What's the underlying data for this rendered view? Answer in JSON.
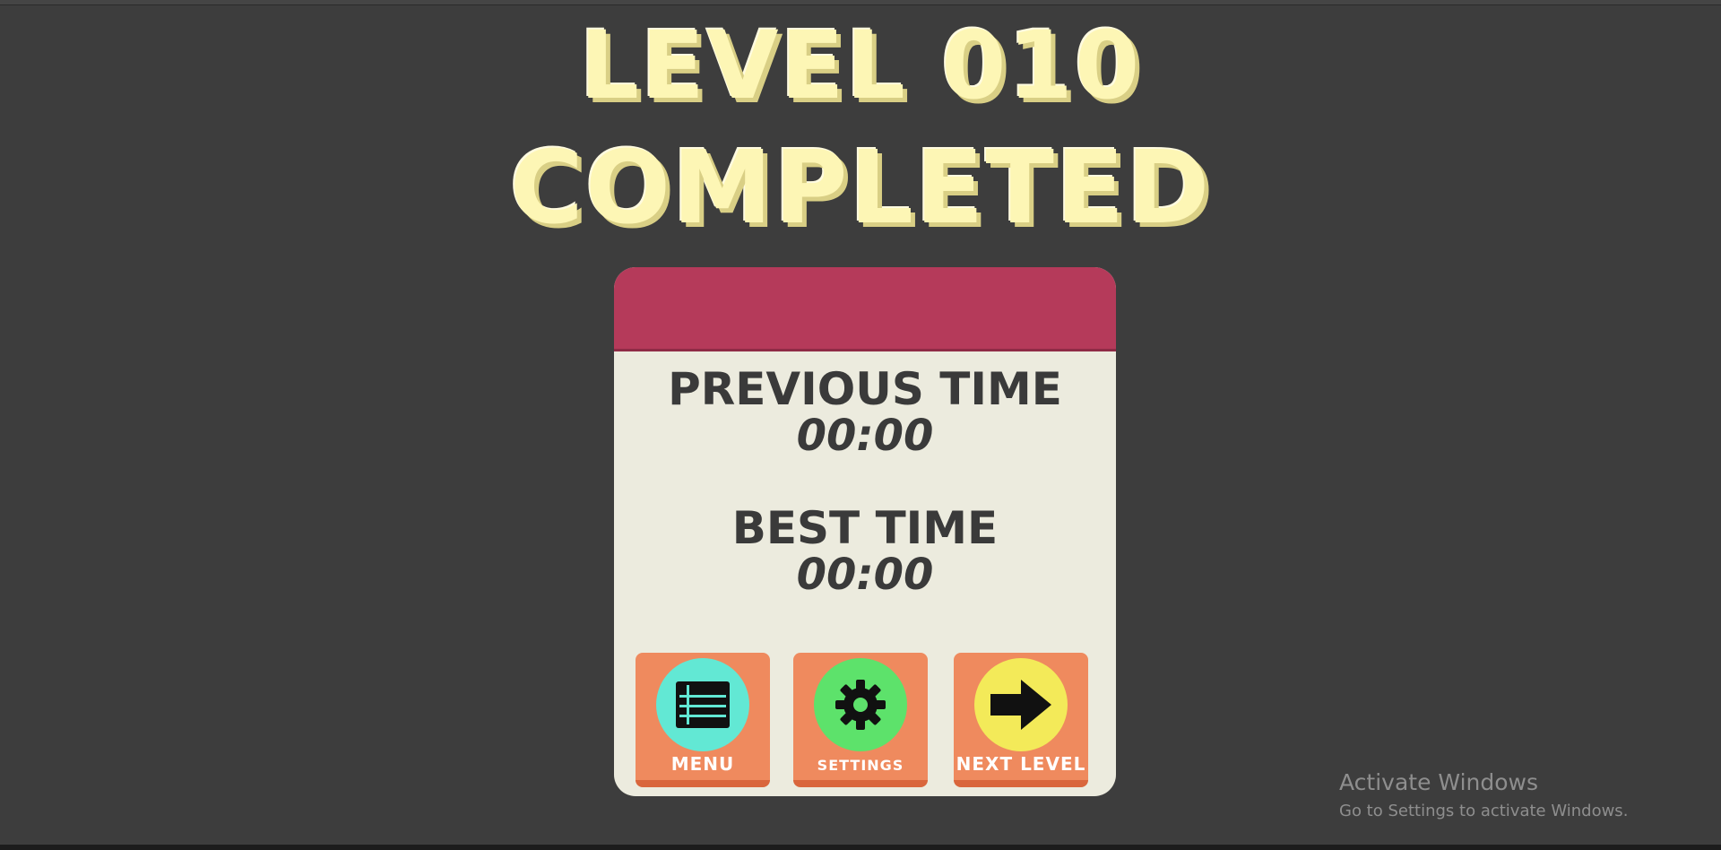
{
  "title": {
    "line1": "LEVEL 010",
    "line2": "COMPLETED"
  },
  "stats": {
    "previous_label": "PREVIOUS TIME",
    "previous_value": "00:00",
    "best_label": "BEST TIME",
    "best_value": "00:00"
  },
  "buttons": {
    "menu": {
      "label": "MENU",
      "icon": "list-icon"
    },
    "settings": {
      "label": "SETTINGS",
      "icon": "gear-icon"
    },
    "next": {
      "label": "NEXT LEVEL",
      "icon": "arrow-right-icon"
    }
  },
  "watermark": {
    "title": "Activate Windows",
    "subtitle": "Go to Settings to activate Windows."
  },
  "colors": {
    "background": "#3d3d3d",
    "title": "#fdf6b5",
    "panel": "#ecebde",
    "header": "#b53a5a",
    "button": "#ef8a5e",
    "menu_circle": "#62e8d4",
    "settings_circle": "#5de26b",
    "next_circle": "#f3ea59"
  }
}
